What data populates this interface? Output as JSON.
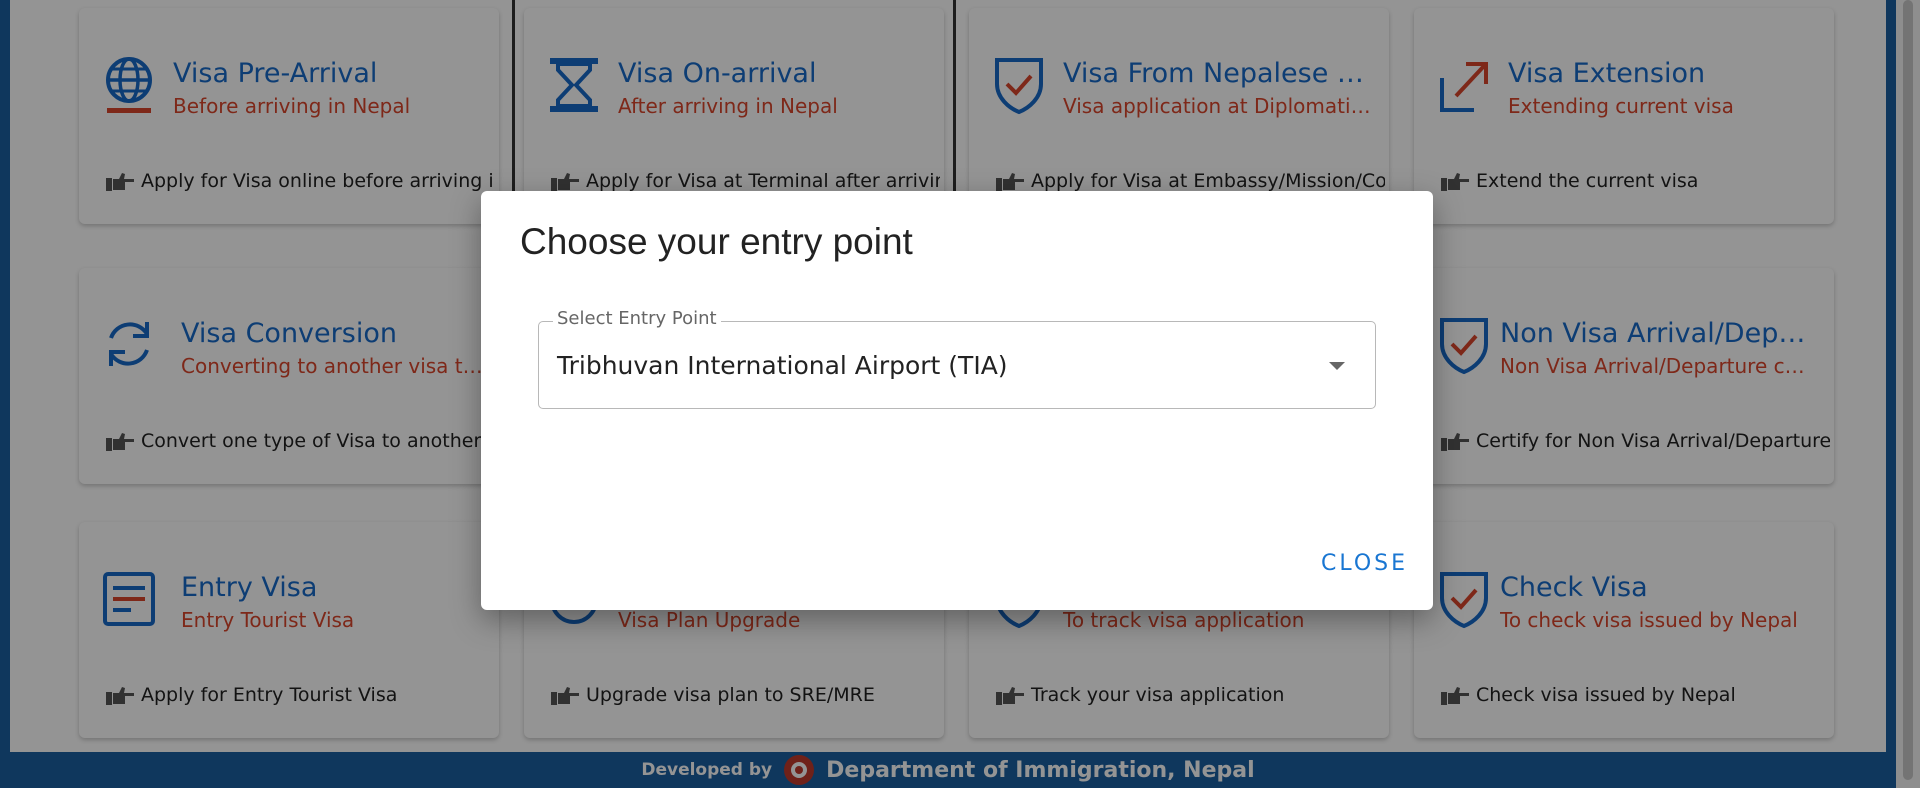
{
  "cards": [
    {
      "title": "Visa Pre-Arrival",
      "subtitle": "Before arriving in Nepal",
      "description": "Apply for Visa online before arriving in Nepal",
      "icon": "globe-icon"
    },
    {
      "title": "Visa On-arrival",
      "subtitle": "After arriving in Nepal",
      "description": "Apply for Visa at Terminal after arriving in Nepal",
      "icon": "hourglass-icon"
    },
    {
      "title": "Visa From Nepalese Diplomatic Mission",
      "subtitle": "Visa application at Diplomatic Mission",
      "description": "Apply for Visa at Embassy/Mission/Consulate",
      "icon": "shield-check-icon"
    },
    {
      "title": "Visa Extension",
      "subtitle": "Extending current visa",
      "description": "Extend the current visa",
      "icon": "arrow-up-right-icon"
    },
    {
      "title": "Visa Conversion",
      "subtitle": "Converting to another visa type",
      "description": "Convert one type of Visa to another",
      "icon": "refresh-icon"
    },
    {
      "title": "Non Visa Arrival/Departure",
      "subtitle": "Non Visa Arrival/Departure certificate",
      "description": "Certify for Non Visa Arrival/Departure",
      "icon": "shield-check-icon"
    },
    {
      "title": "Entry Visa",
      "subtitle": "Entry Tourist Visa",
      "description": "Apply for Entry Tourist Visa",
      "icon": "document-lines-icon"
    },
    {
      "title": "",
      "subtitle": "Visa Plan Upgrade",
      "description": "Upgrade visa plan to SRE/MRE",
      "icon": "upgrade-icon"
    },
    {
      "title": "",
      "subtitle": "To track visa application",
      "description": "Track your visa application",
      "icon": "shield-check-icon"
    },
    {
      "title": "Check Visa",
      "subtitle": "To check visa issued by Nepal",
      "description": "Check visa issued by Nepal",
      "icon": "shield-check-icon"
    }
  ],
  "dialog": {
    "title": "Choose your entry point",
    "select_label": "Select Entry Point",
    "select_value": "Tribhuvan International Airport (TIA)",
    "close_label": "CLOSE"
  },
  "footer": {
    "developed_by": "Developed by",
    "department": "Department of Immigration, Nepal"
  },
  "colors": {
    "title_blue": "#1769c8",
    "subtitle_red": "#d9452b",
    "bar_blue": "#1a5fa0",
    "close_blue": "#1976d2"
  }
}
